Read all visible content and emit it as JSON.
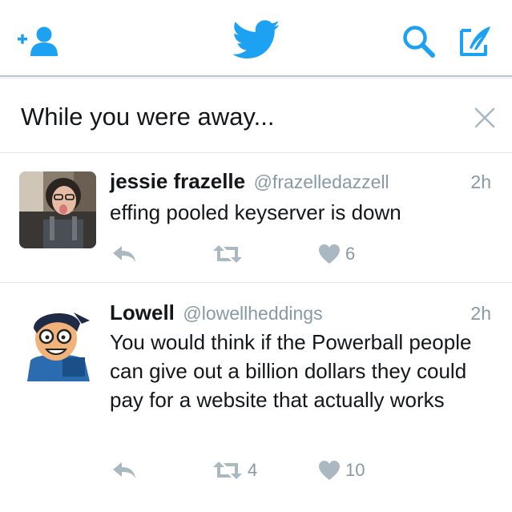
{
  "header": {
    "icons": [
      "add-user-icon",
      "twitter-bird-icon",
      "search-icon",
      "compose-tweet-icon"
    ],
    "accent_color": "#1da1f2"
  },
  "away_banner": {
    "title": "While you were away..."
  },
  "tweets": [
    {
      "name": "jessie frazelle",
      "handle": "@frazelledazzell",
      "time": "2h",
      "text": "effing pooled keyserver is down",
      "retweets": "",
      "likes": "6"
    },
    {
      "name": "Lowell",
      "handle": "@lowellheddings",
      "time": "2h",
      "text": "You would think if the Powerball people can give out a billion dollars they could pay for a website that actually works",
      "retweets": "4",
      "likes": "10"
    }
  ],
  "colors": {
    "icon_gray": "#aab8c2",
    "secondary_text": "#8899a6",
    "divider": "#e1e8ed"
  }
}
